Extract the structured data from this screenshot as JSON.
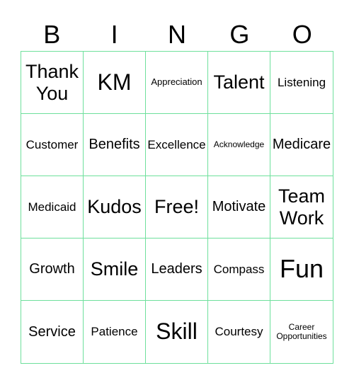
{
  "header": {
    "letters": [
      "B",
      "I",
      "N",
      "G",
      "O"
    ]
  },
  "border_color": "#6ee09c",
  "grid": [
    [
      {
        "text": "Thank You",
        "size": "xl"
      },
      {
        "text": "KM",
        "size": "xxl"
      },
      {
        "text": "Appreciation",
        "size": "sm"
      },
      {
        "text": "Talent",
        "size": "xl"
      },
      {
        "text": "Listening",
        "size": "md"
      }
    ],
    [
      {
        "text": "Customer",
        "size": "md"
      },
      {
        "text": "Benefits",
        "size": "lg"
      },
      {
        "text": "Excellence",
        "size": "md"
      },
      {
        "text": "Acknowledge",
        "size": "xs"
      },
      {
        "text": "Medicare",
        "size": "lg"
      }
    ],
    [
      {
        "text": "Medicaid",
        "size": "md"
      },
      {
        "text": "Kudos",
        "size": "xl"
      },
      {
        "text": "Free!",
        "size": "xl"
      },
      {
        "text": "Motivate",
        "size": "lg"
      },
      {
        "text": "Team Work",
        "size": "xl"
      }
    ],
    [
      {
        "text": "Growth",
        "size": "lg"
      },
      {
        "text": "Smile",
        "size": "xl"
      },
      {
        "text": "Leaders",
        "size": "lg"
      },
      {
        "text": "Compass",
        "size": "md"
      },
      {
        "text": "Fun",
        "size": "xxxl"
      }
    ],
    [
      {
        "text": "Service",
        "size": "lg"
      },
      {
        "text": "Patience",
        "size": "md"
      },
      {
        "text": "Skill",
        "size": "xxl"
      },
      {
        "text": "Courtesy",
        "size": "md"
      },
      {
        "text": "Career Opportunities",
        "size": "xs"
      }
    ]
  ]
}
